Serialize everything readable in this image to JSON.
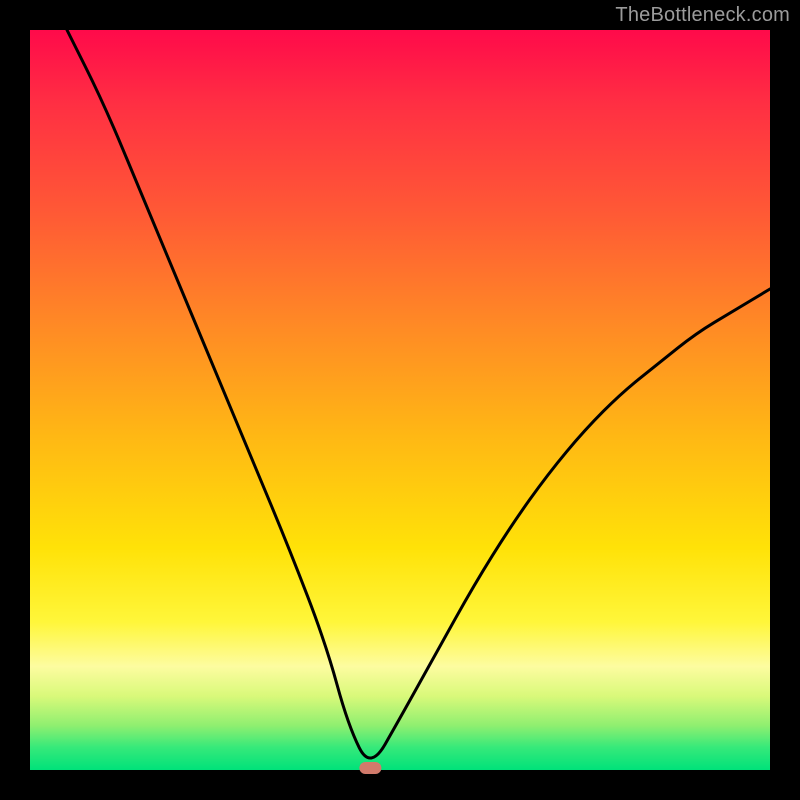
{
  "watermark": "TheBottleneck.com",
  "colors": {
    "curve": "#000000",
    "marker": "#d17a6b",
    "gradient_stops": [
      "#ff0a4a",
      "#ff5a35",
      "#ffb814",
      "#fff63a",
      "#fdfca0",
      "#35e97a",
      "#00e27a"
    ]
  },
  "chart_data": {
    "type": "line",
    "title": "",
    "xlabel": "",
    "ylabel": "",
    "xlim": [
      0,
      100
    ],
    "ylim": [
      0,
      100
    ],
    "grid": false,
    "legend": false,
    "notes": "V-shaped bottleneck curve on red→green vertical gradient; minimum marked near x≈45 at y≈0. Axis is unlabeled; values are relative percentages read from pixel position.",
    "series": [
      {
        "name": "bottleneck-curve",
        "x": [
          5,
          10,
          15,
          20,
          25,
          30,
          35,
          40,
          43,
          46,
          50,
          55,
          60,
          65,
          70,
          75,
          80,
          85,
          90,
          95,
          100
        ],
        "values": [
          100,
          90,
          78,
          66,
          54,
          42,
          30,
          17,
          6,
          0,
          7,
          16,
          25,
          33,
          40,
          46,
          51,
          55,
          59,
          62,
          65
        ]
      }
    ],
    "marker": {
      "x": 46,
      "y": 0
    }
  }
}
